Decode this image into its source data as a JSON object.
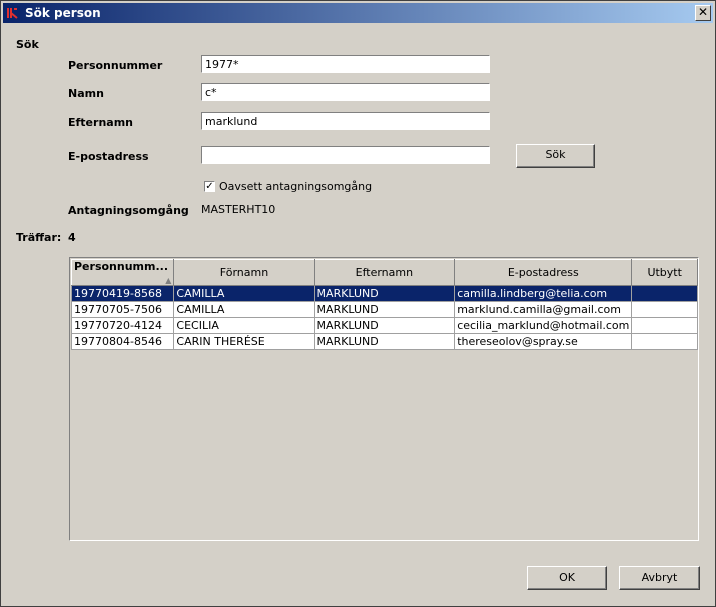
{
  "window": {
    "title": "Sök person"
  },
  "search": {
    "section_label": "Sök",
    "personnummer_label": "Personnummer",
    "personnummer_value": "1977*",
    "namn_label": "Namn",
    "namn_value": "c*",
    "efternamn_label": "Efternamn",
    "efternamn_value": "marklund",
    "epost_label": "E-postadress",
    "epost_value": "",
    "search_button": "Sök",
    "checkbox_label": "Oavsett antagningsomgång",
    "checkbox_checked": true,
    "omgang_label": "Antagningsomgång",
    "omgang_value": "MASTERHT10"
  },
  "results": {
    "label": "Träffar:",
    "count": "4",
    "columns": [
      "Personnumm...",
      "Förnamn",
      "Efternamn",
      "E-postadress",
      "Utbytt"
    ],
    "rows": [
      [
        "19770419-8568",
        "CAMILLA",
        "MARKLUND",
        "camilla.lindberg@telia.com",
        ""
      ],
      [
        "19770705-7506",
        "CAMILLA",
        "MARKLUND",
        "marklund.camilla@gmail.com",
        ""
      ],
      [
        "19770720-4124",
        "CECILIA",
        "MARKLUND",
        "cecilia_marklund@hotmail.com",
        ""
      ],
      [
        "19770804-8546",
        "CARIN THERÉSE",
        "MARKLUND",
        "thereseolov@spray.se",
        ""
      ]
    ],
    "selected_row": 0
  },
  "footer": {
    "ok_button": "OK",
    "cancel_button": "Avbryt"
  }
}
